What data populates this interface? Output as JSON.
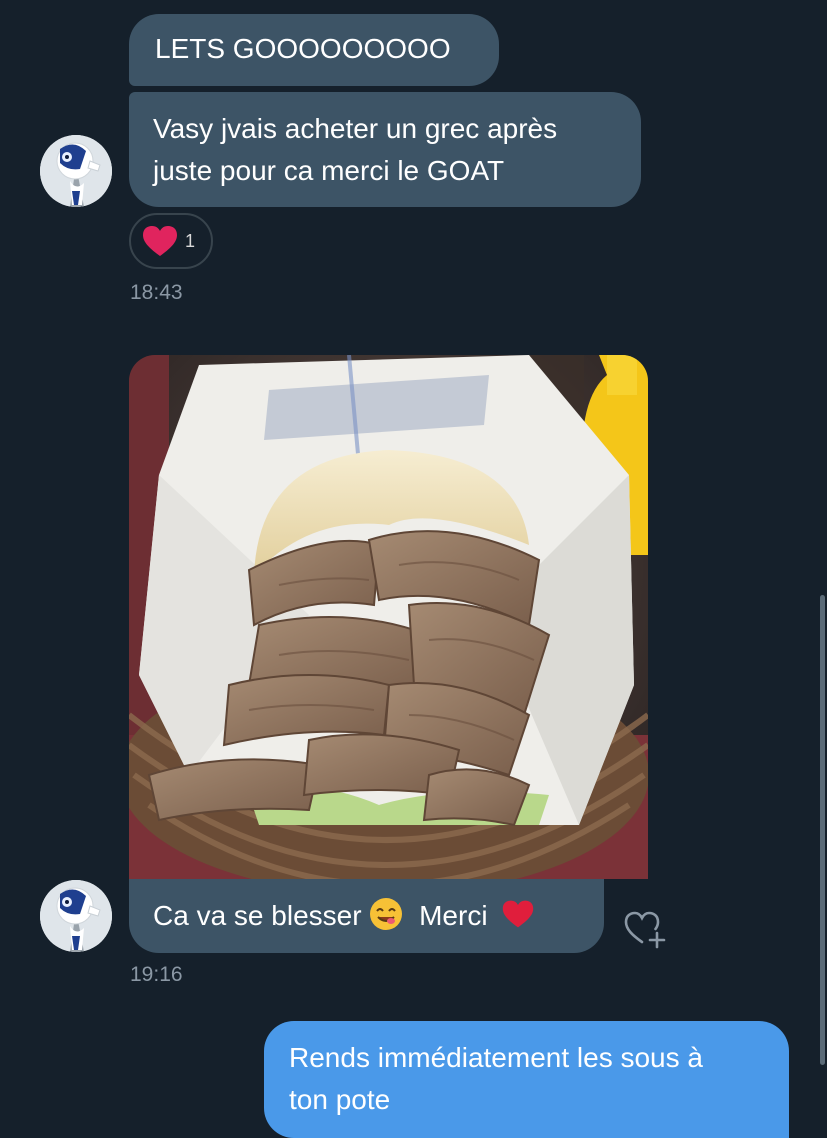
{
  "messages": {
    "m1": {
      "text": "LETS GOOOOOOOOO"
    },
    "m2": {
      "line1": "Vasy jvais acheter un grec après",
      "line2": "juste pour ca merci le GOAT"
    },
    "m3": {
      "text_before": "Ca va se blesser",
      "text_after": "Merci"
    },
    "m4": {
      "line1": "Rends immédiatement les sous à",
      "line2": "ton pote"
    }
  },
  "reaction": {
    "icon": "heart-icon",
    "count": "1"
  },
  "timestamps": {
    "t1": "18:43",
    "t2": "19:16"
  },
  "photo": {
    "subject": "kebab-sandwich-photo"
  },
  "icons": {
    "avatar": "robot-avatar-icon",
    "react": "add-reaction-heart-icon",
    "emoji1": "yum-face-emoji",
    "emoji2": "red-heart-emoji"
  },
  "colors": {
    "background": "#15202b",
    "incoming_bubble": "#3d5466",
    "outgoing_bubble": "#4a99e9",
    "timestamp": "#8b98a5",
    "heart": "#e0245e"
  }
}
